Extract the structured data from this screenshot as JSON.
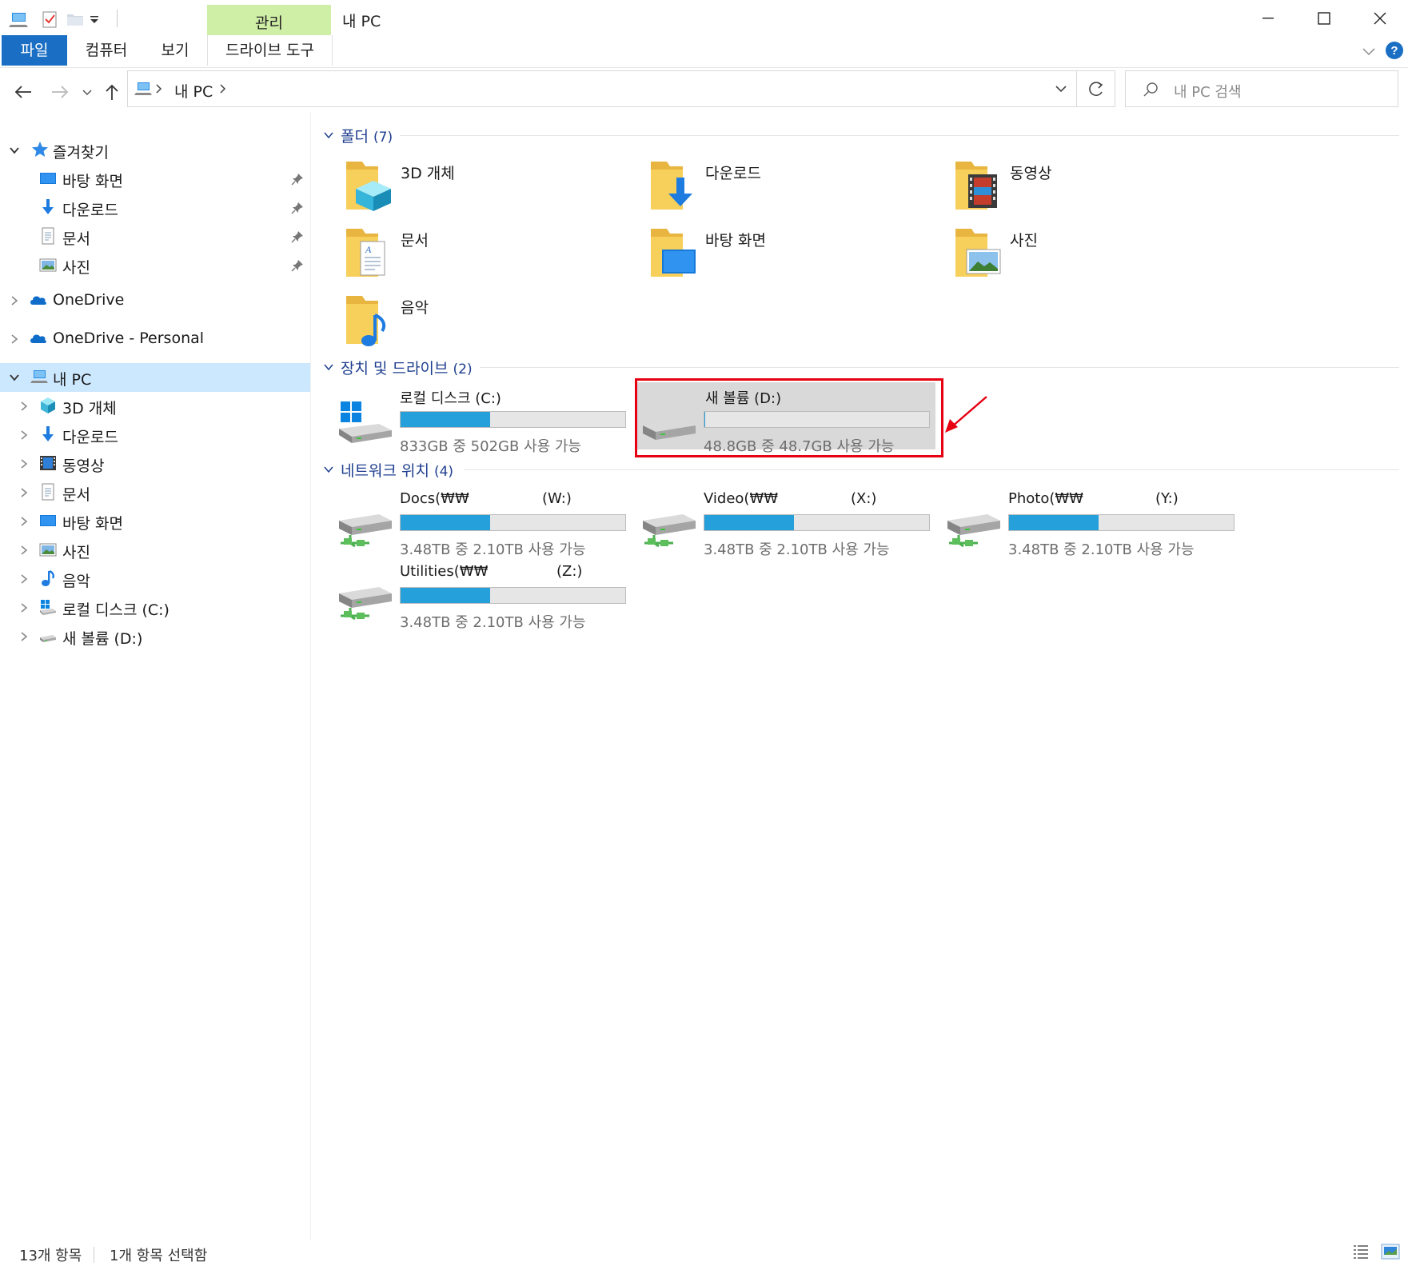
{
  "window": {
    "title": "내 PC",
    "context_tab_group": "관리"
  },
  "ribbon": {
    "tabs": [
      {
        "label": "파일",
        "active": true
      },
      {
        "label": "컴퓨터"
      },
      {
        "label": "보기"
      },
      {
        "label": "드라이브 도구"
      }
    ]
  },
  "address": {
    "breadcrumb": [
      "내 PC"
    ]
  },
  "search": {
    "placeholder": "내 PC 검색"
  },
  "sidebar": {
    "quick_access": {
      "label": "즐겨찾기",
      "items": [
        {
          "label": "바탕 화면",
          "icon": "desktop-icon"
        },
        {
          "label": "다운로드",
          "icon": "download-icon"
        },
        {
          "label": "문서",
          "icon": "document-icon"
        },
        {
          "label": "사진",
          "icon": "picture-icon"
        }
      ]
    },
    "onedrive": "OneDrive",
    "onedrive_personal": "OneDrive - Personal",
    "this_pc": {
      "label": "내 PC",
      "children": [
        {
          "label": "3D 개체",
          "icon": "3d-objects-icon"
        },
        {
          "label": "다운로드",
          "icon": "download-icon"
        },
        {
          "label": "동영상",
          "icon": "video-icon"
        },
        {
          "label": "문서",
          "icon": "document-icon"
        },
        {
          "label": "바탕 화면",
          "icon": "desktop-icon"
        },
        {
          "label": "사진",
          "icon": "picture-icon"
        },
        {
          "label": "음악",
          "icon": "music-icon"
        },
        {
          "label": "로컬 디스크 (C:)",
          "icon": "windows-drive-icon"
        },
        {
          "label": "새 볼륨 (D:)",
          "icon": "drive-icon"
        }
      ]
    }
  },
  "content": {
    "folders_group": {
      "label": "폴더",
      "count": "(7)"
    },
    "folders": [
      {
        "label": "3D 개체",
        "icon": "3d-objects-folder-icon"
      },
      {
        "label": "다운로드",
        "icon": "downloads-folder-icon"
      },
      {
        "label": "동영상",
        "icon": "videos-folder-icon"
      },
      {
        "label": "문서",
        "icon": "documents-folder-icon"
      },
      {
        "label": "바탕 화면",
        "icon": "desktop-folder-icon"
      },
      {
        "label": "사진",
        "icon": "pictures-folder-icon"
      },
      {
        "label": "음악",
        "icon": "music-folder-icon"
      }
    ],
    "drives_group": {
      "label": "장치 및 드라이브",
      "count": "(2)"
    },
    "drives": [
      {
        "name": "로컬 디스크 (C:)",
        "free_text": "833GB 중 502GB 사용 가능",
        "used_fraction": 0.4,
        "icon": "windows-drive-icon"
      },
      {
        "name": "새 볼륨 (D:)",
        "free_text": "48.8GB 중 48.7GB 사용 가능",
        "used_fraction": 0.002,
        "icon": "drive-icon",
        "selected": true
      }
    ],
    "network_group": {
      "label": "네트워크 위치",
      "count": "(4)"
    },
    "network": [
      {
        "name": "Docs(₩₩",
        "letter": "(W:)",
        "free_text": "3.48TB 중 2.10TB 사용 가능",
        "used_fraction": 0.4
      },
      {
        "name": "Video(₩₩",
        "letter": "(X:)",
        "free_text": "3.48TB 중 2.10TB 사용 가능",
        "used_fraction": 0.4
      },
      {
        "name": "Photo(₩₩",
        "letter": "(Y:)",
        "free_text": "3.48TB 중 2.10TB 사용 가능",
        "used_fraction": 0.4
      },
      {
        "name": "Utilities(₩₩",
        "letter": "(Z:)",
        "free_text": "3.48TB 중 2.10TB 사용 가능",
        "used_fraction": 0.4
      }
    ]
  },
  "status": {
    "item_count": "13개 항목",
    "selection": "1개 항목 선택함"
  },
  "colors": {
    "accent": "#1a6fc4",
    "selection_bg": "#cce8ff",
    "context_tab": "#cfeea6",
    "usage_bar": "#26a0da",
    "annotation": "#e60012"
  }
}
